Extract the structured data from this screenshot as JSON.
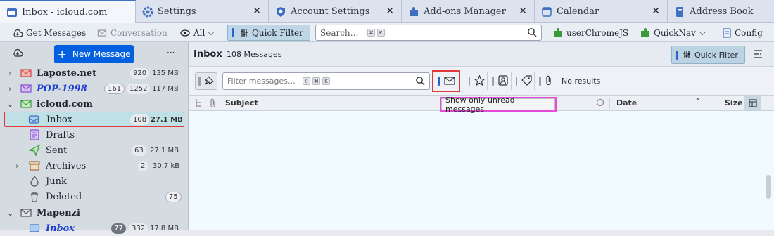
{
  "tabs": [
    {
      "label": "Inbox - icloud.com",
      "icon": "mail-icon"
    },
    {
      "label": "Settings",
      "icon": "gear-icon"
    },
    {
      "label": "Account Settings",
      "icon": "account-icon"
    },
    {
      "label": "Add-ons Manager",
      "icon": "puzzle-icon"
    },
    {
      "label": "Calendar",
      "icon": "calendar-icon"
    },
    {
      "label": "Address Book",
      "icon": "addressbook-icon"
    }
  ],
  "toolbar": {
    "get_messages": "Get Messages",
    "conversation": "Conversation",
    "view_all": "All",
    "quick_filter": "Quick Filter",
    "search_placeholder": "Search…",
    "kbd1": "⌘",
    "kbd2": "K",
    "userchromejs": "userChromeJS",
    "quicknav": "QuickNav",
    "config": "Config"
  },
  "sidebar": {
    "new_message": "New Message",
    "more": "···",
    "accounts": [
      {
        "name": "Laposte.net",
        "count": "920",
        "size": "135 MB"
      },
      {
        "name": "POP-1998",
        "unread": "161",
        "count": "1252",
        "size": "117 MB"
      },
      {
        "name": "icloud.com"
      }
    ],
    "folders": [
      {
        "name": "Inbox",
        "count": "108",
        "size": "27.1 MB"
      },
      {
        "name": "Drafts"
      },
      {
        "name": "Sent",
        "count": "63",
        "size": "27.1 MB"
      },
      {
        "name": "Archives",
        "count": "2",
        "size": "30.7 kB"
      },
      {
        "name": "Junk"
      },
      {
        "name": "Deleted",
        "count": "75"
      }
    ],
    "mapenzi": {
      "name": "Mapenzi",
      "inbox": "Inbox",
      "unread": "77",
      "count": "332",
      "size": "17.8 MB"
    }
  },
  "main": {
    "folder_title": "Inbox",
    "message_count": "108 Messages",
    "quick_filter_button": "Quick Filter",
    "filter_placeholder": "Filter messages…",
    "kbd_shift": "⇧",
    "kbd_cmd": "⌘",
    "kbd_k": "K",
    "no_results": "No results",
    "tooltip": "Show only unread messages",
    "columns": {
      "subject": "Subject",
      "date": "Date",
      "size": "Size"
    }
  },
  "colors": {
    "accent": "#0060df",
    "highlight_red": "#e23a3a",
    "tooltip_border": "#e64ad8"
  }
}
